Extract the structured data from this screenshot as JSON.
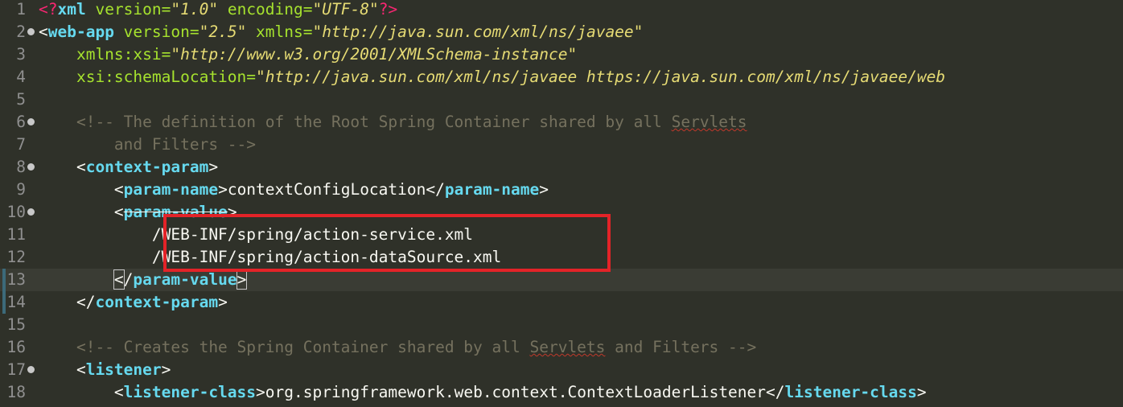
{
  "lines": [
    {
      "num": "1",
      "tokens": [
        {
          "t": "<?",
          "c": "pi"
        },
        {
          "t": "xml",
          "c": "tag"
        },
        {
          "t": " version=",
          "c": "attr"
        },
        {
          "t": "\"1.0\"",
          "c": "val"
        },
        {
          "t": " encoding=",
          "c": "attr"
        },
        {
          "t": "\"UTF-8\"",
          "c": "val"
        },
        {
          "t": "?>",
          "c": "pi"
        }
      ]
    },
    {
      "num": "2",
      "fold": true,
      "tokens": [
        {
          "t": "<",
          "c": "bracket"
        },
        {
          "t": "web-app",
          "c": "tag"
        },
        {
          "t": " version=",
          "c": "attr"
        },
        {
          "t": "\"2.5\"",
          "c": "val"
        },
        {
          "t": " xmlns=",
          "c": "attr"
        },
        {
          "t": "\"http://java.sun.com/xml/ns/javaee\"",
          "c": "val"
        }
      ]
    },
    {
      "num": "3",
      "tokens": [
        {
          "t": "    xmlns:xsi=",
          "c": "attr"
        },
        {
          "t": "\"http://www.w3.org/2001/XMLSchema-instance\"",
          "c": "val"
        }
      ]
    },
    {
      "num": "4",
      "tokens": [
        {
          "t": "    xsi:schemaLocation=",
          "c": "attr"
        },
        {
          "t": "\"http://java.sun.com/xml/ns/javaee https://java.sun.com/xml/ns/javaee/web",
          "c": "val"
        }
      ]
    },
    {
      "num": "5",
      "tokens": []
    },
    {
      "num": "6",
      "fold": true,
      "tokens": [
        {
          "t": "    <!-- The definition of the Root Spring Container shared by all ",
          "c": "comment"
        },
        {
          "t": "Servlets",
          "c": "comment",
          "spell": true
        }
      ]
    },
    {
      "num": "7",
      "tokens": [
        {
          "t": "        and Filters -->",
          "c": "comment"
        }
      ]
    },
    {
      "num": "8",
      "fold": true,
      "tokens": [
        {
          "t": "    <",
          "c": "bracket"
        },
        {
          "t": "context-param",
          "c": "tag"
        },
        {
          "t": ">",
          "c": "bracket"
        }
      ]
    },
    {
      "num": "9",
      "tokens": [
        {
          "t": "        <",
          "c": "bracket"
        },
        {
          "t": "param-name",
          "c": "tag"
        },
        {
          "t": ">",
          "c": "bracket"
        },
        {
          "t": "contextConfigLocation",
          "c": "text"
        },
        {
          "t": "</",
          "c": "bracket"
        },
        {
          "t": "param-name",
          "c": "tag"
        },
        {
          "t": ">",
          "c": "bracket"
        }
      ]
    },
    {
      "num": "10",
      "fold": true,
      "tokens": [
        {
          "t": "        <",
          "c": "bracket"
        },
        {
          "t": "param-value",
          "c": "tag",
          "strike": true
        },
        {
          "t": ">",
          "c": "bracket"
        }
      ]
    },
    {
      "num": "11",
      "tokens": [
        {
          "t": "            /WEB-INF/spring/action-service.xml",
          "c": "text"
        }
      ]
    },
    {
      "num": "12",
      "tokens": [
        {
          "t": "            /WEB-INF/spring/action-dataSource.xml",
          "c": "text"
        }
      ]
    },
    {
      "num": "13",
      "current": true,
      "marker": true,
      "tokens": [
        {
          "t": "        ",
          "c": "text"
        },
        {
          "t": "<",
          "c": "bracket",
          "box": true
        },
        {
          "t": "/",
          "c": "bracket"
        },
        {
          "t": "param-value",
          "c": "tag"
        },
        {
          "t": ">",
          "c": "bracket",
          "box": true
        },
        {
          "t": "",
          "c": "caret"
        }
      ]
    },
    {
      "num": "14",
      "marker": true,
      "tokens": [
        {
          "t": "    </",
          "c": "bracket"
        },
        {
          "t": "context-param",
          "c": "tag"
        },
        {
          "t": ">",
          "c": "bracket"
        }
      ]
    },
    {
      "num": "15",
      "tokens": []
    },
    {
      "num": "16",
      "tokens": [
        {
          "t": "    <!-- Creates the Spring Container shared by all ",
          "c": "comment"
        },
        {
          "t": "Servlets",
          "c": "comment",
          "spell": true
        },
        {
          "t": " and Filters -->",
          "c": "comment"
        }
      ]
    },
    {
      "num": "17",
      "fold": true,
      "tokens": [
        {
          "t": "    <",
          "c": "bracket"
        },
        {
          "t": "listener",
          "c": "tag"
        },
        {
          "t": ">",
          "c": "bracket"
        }
      ]
    },
    {
      "num": "18",
      "tokens": [
        {
          "t": "        <",
          "c": "bracket"
        },
        {
          "t": "listener-class",
          "c": "tag"
        },
        {
          "t": ">",
          "c": "bracket"
        },
        {
          "t": "org.springframework.web.context.ContextLoaderListener",
          "c": "text"
        },
        {
          "t": "</",
          "c": "bracket"
        },
        {
          "t": "listener-class",
          "c": "tag"
        },
        {
          "t": ">",
          "c": "bracket"
        }
      ]
    }
  ],
  "colors": {
    "background": "#2f3129",
    "tag": "#66d9ef",
    "attribute": "#a6e22e",
    "value": "#e6db74",
    "comment": "#75715e",
    "text": "#f8f8f2",
    "pi": "#f92672",
    "annotation_box": "#e32328"
  }
}
